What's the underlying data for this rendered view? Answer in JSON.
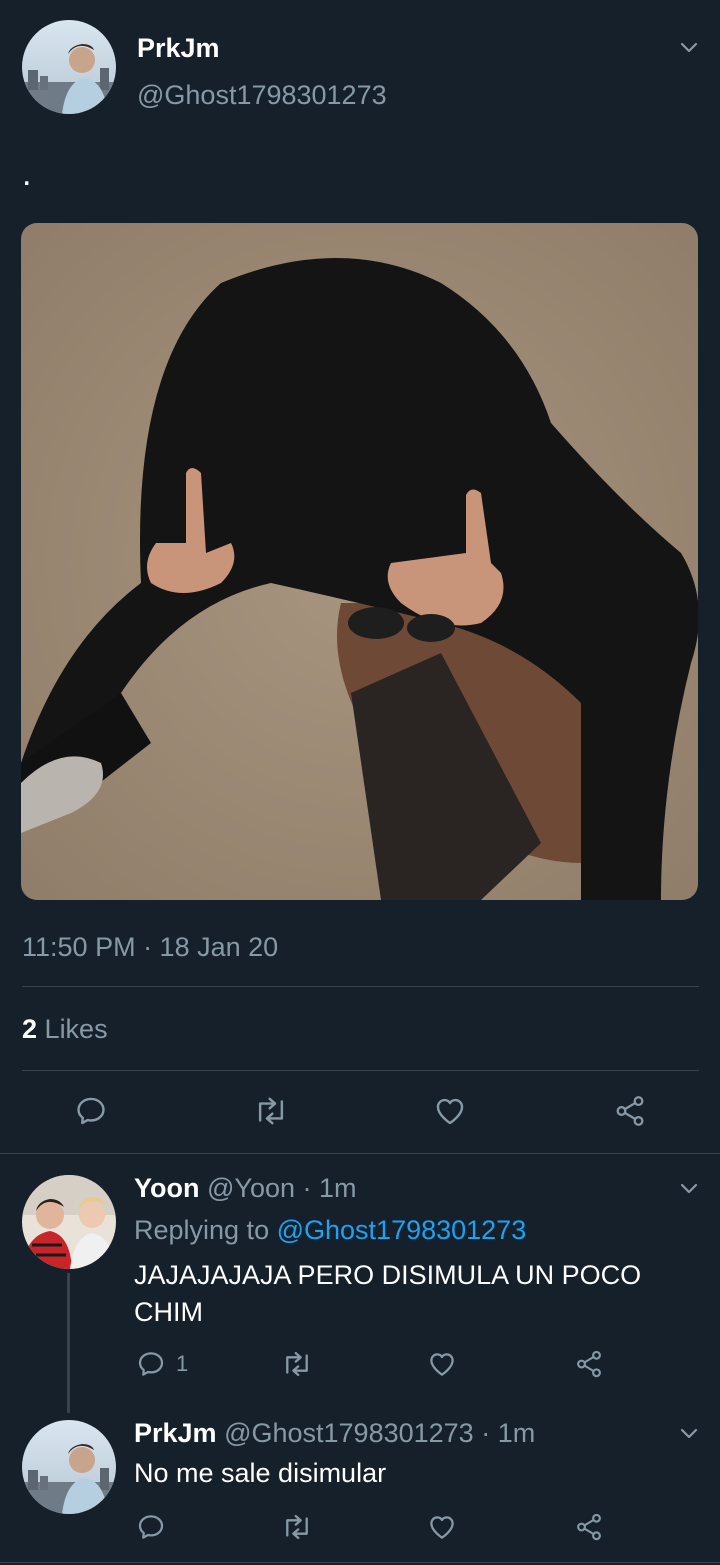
{
  "main_tweet": {
    "name": "PrkJm",
    "handle": "@Ghost1798301273",
    "text": ".",
    "timestamp": "11:50 PM · 18 Jan 20",
    "likes_count": "2",
    "likes_label": "Likes"
  },
  "replies": [
    {
      "name": "Yoon",
      "handle": "@Yoon",
      "time": "· 1m",
      "replying_prefix": "Replying to",
      "replying_handle": "@Ghost1798301273",
      "text_line1": "JAJAJAJAJA PERO DISIMULA UN POCO",
      "text_line2": "CHIM",
      "reply_count": "1"
    },
    {
      "name": "PrkJm",
      "handle": "@Ghost1798301273",
      "time": "· 1m",
      "text": "No me sale disimular"
    }
  ],
  "colors": {
    "background": "#15202b",
    "muted": "#8899a6",
    "link": "#1da1f2",
    "divider": "#38444d"
  },
  "icons": [
    "chevron-down-icon",
    "reply-icon",
    "retweet-icon",
    "like-icon",
    "share-icon"
  ]
}
